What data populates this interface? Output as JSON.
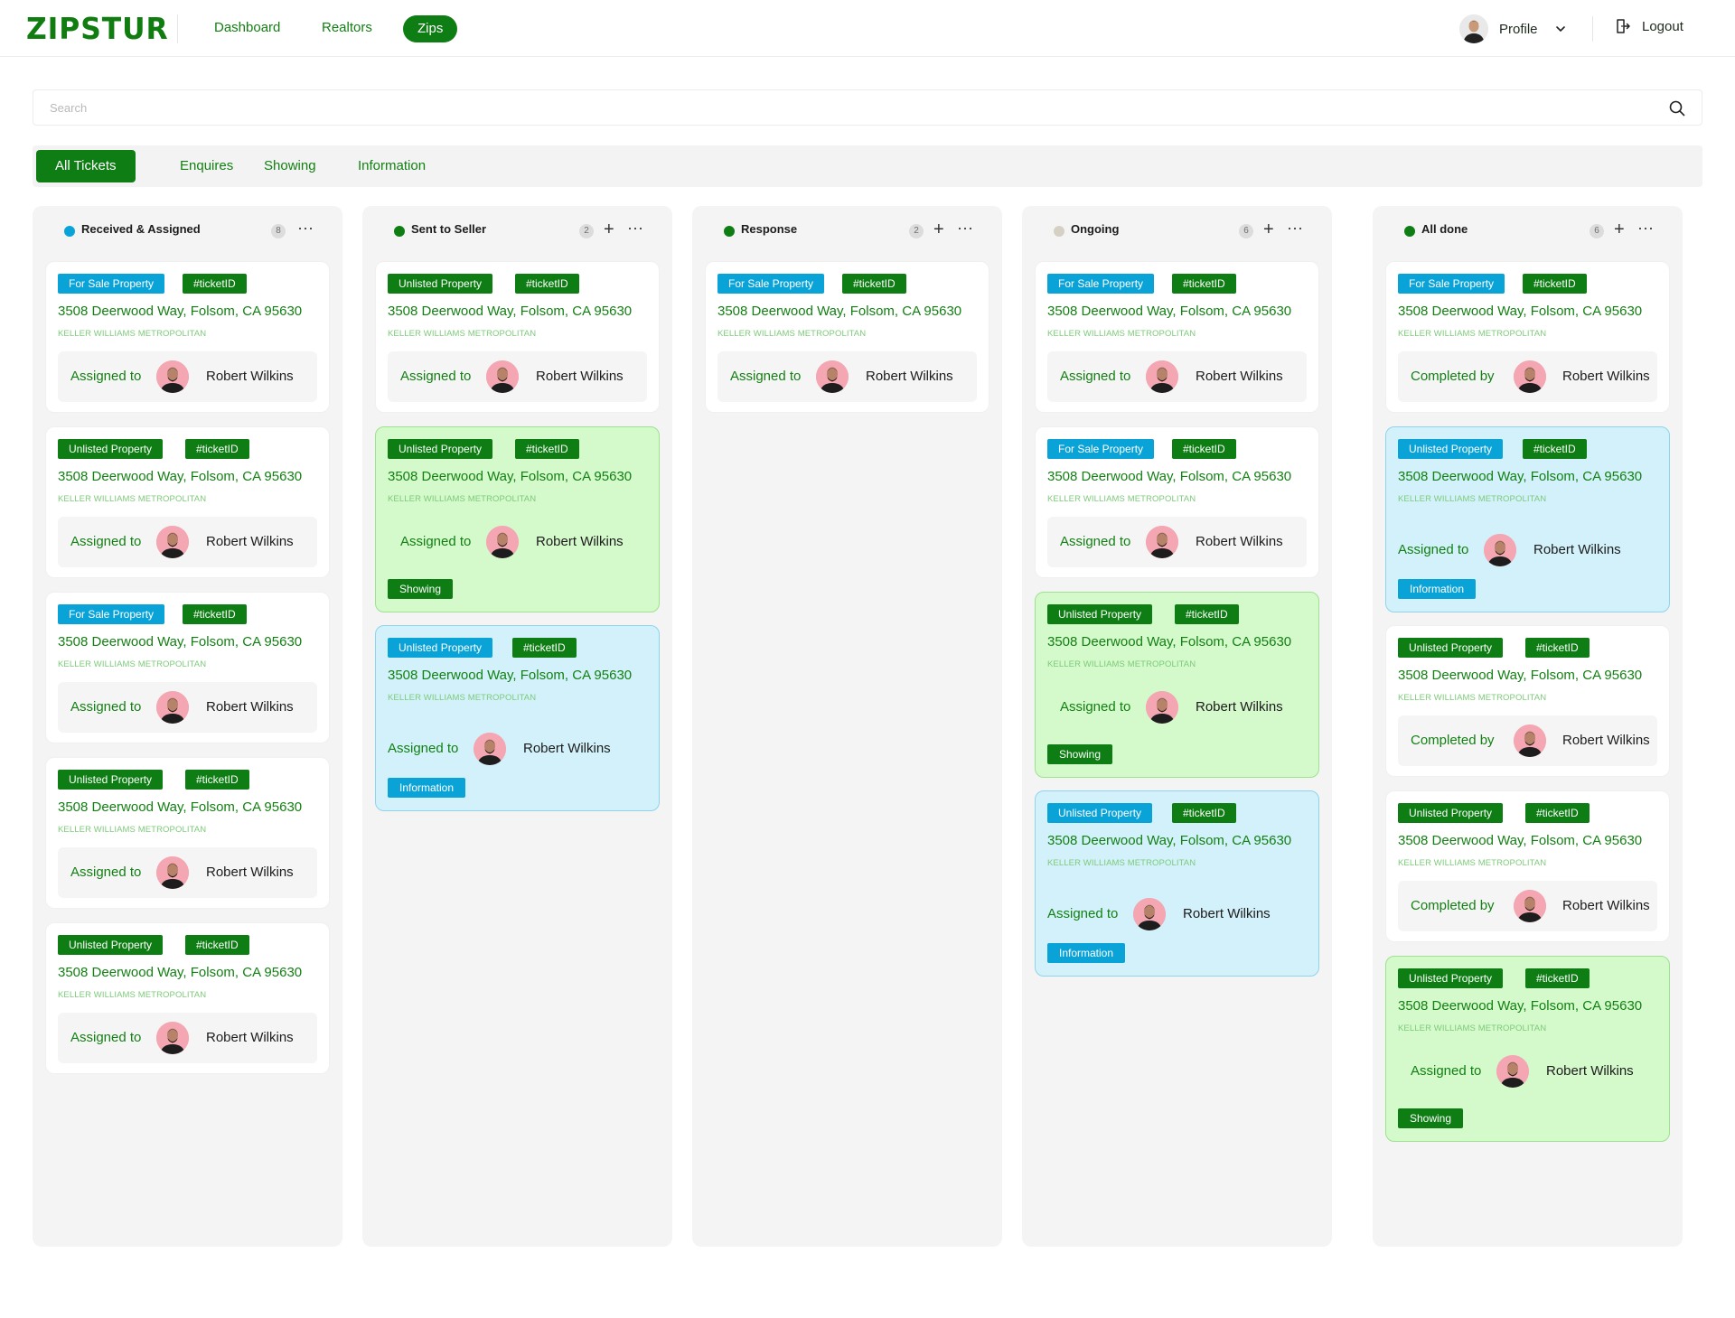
{
  "app": {
    "logo": "ZIPSTUR",
    "nav": [
      "Dashboard",
      "Realtors",
      "Zips"
    ],
    "profile_label": "Profile",
    "logout_label": "Logout"
  },
  "search": {
    "placeholder": "Search"
  },
  "tabs": [
    "All Tickets",
    "Enquires",
    "Showing",
    "Information"
  ],
  "colors": {
    "brand_green": "#0e7d14",
    "sale_blue": "#0aa3d8",
    "showing_bg": "#d4f9cb",
    "info_bg": "#d2f1fa"
  },
  "columns": [
    {
      "title": "Received & Assigned",
      "count": "8",
      "dot": "#0aa3d8",
      "has_plus": false,
      "cards": [
        {
          "type": "For Sale Property",
          "kind": "sale",
          "ticket": "#ticketID",
          "address": "3508 Deerwood Way, Folsom, CA 95630",
          "agency": "KELLER WILLIAMS METROPOLITAN",
          "by_label": "Assigned to",
          "person": "Robert Wilkins",
          "style": "plain",
          "status": ""
        },
        {
          "type": "Unlisted Property",
          "kind": "unlisted",
          "ticket": "#ticketID",
          "address": "3508 Deerwood Way, Folsom, CA 95630",
          "agency": "KELLER WILLIAMS METROPOLITAN",
          "by_label": "Assigned to",
          "person": "Robert Wilkins",
          "style": "plain",
          "status": ""
        },
        {
          "type": "For Sale Property",
          "kind": "sale",
          "ticket": "#ticketID",
          "address": "3508 Deerwood Way, Folsom, CA 95630",
          "agency": "KELLER WILLIAMS METROPOLITAN",
          "by_label": "Assigned to",
          "person": "Robert Wilkins",
          "style": "plain",
          "status": ""
        },
        {
          "type": "Unlisted Property",
          "kind": "unlisted",
          "ticket": "#ticketID",
          "address": "3508 Deerwood Way, Folsom, CA 95630",
          "agency": "KELLER WILLIAMS METROPOLITAN",
          "by_label": "Assigned to",
          "person": "Robert Wilkins",
          "style": "plain",
          "status": ""
        },
        {
          "type": "Unlisted Property",
          "kind": "unlisted",
          "ticket": "#ticketID",
          "address": "3508 Deerwood Way, Folsom, CA 95630",
          "agency": "KELLER WILLIAMS METROPOLITAN",
          "by_label": "Assigned to",
          "person": "Robert Wilkins",
          "style": "plain",
          "status": ""
        }
      ]
    },
    {
      "title": "Sent to Seller",
      "count": "2",
      "dot": "#0e7d14",
      "has_plus": true,
      "cards": [
        {
          "type": "Unlisted Property",
          "kind": "unlisted",
          "ticket": "#ticketID",
          "address": "3508 Deerwood Way, Folsom, CA 95630",
          "agency": "KELLER WILLIAMS METROPOLITAN",
          "by_label": "Assigned to",
          "person": "Robert Wilkins",
          "style": "plain",
          "status": ""
        },
        {
          "type": "Unlisted Property",
          "kind": "unlisted",
          "ticket": "#ticketID",
          "address": "3508 Deerwood Way, Folsom, CA 95630",
          "agency": "KELLER WILLIAMS METROPOLITAN",
          "by_label": "Assigned to",
          "person": "Robert Wilkins",
          "style": "green",
          "status": "Showing"
        },
        {
          "type": "Unlisted Property",
          "kind": "sale",
          "ticket": "#ticketID",
          "address": "3508 Deerwood Way, Folsom, CA 95630",
          "agency": "KELLER WILLIAMS METROPOLITAN",
          "by_label": "Assigned to",
          "person": "Robert Wilkins",
          "style": "blue",
          "status": "Information"
        }
      ]
    },
    {
      "title": "Response",
      "count": "2",
      "dot": "#0e7d14",
      "has_plus": true,
      "cards": [
        {
          "type": "For Sale Property",
          "kind": "sale",
          "ticket": "#ticketID",
          "address": "3508 Deerwood Way, Folsom, CA 95630",
          "agency": "KELLER WILLIAMS METROPOLITAN",
          "by_label": "Assigned to",
          "person": "Robert Wilkins",
          "style": "plain",
          "status": ""
        }
      ]
    },
    {
      "title": "Ongoing",
      "count": "6",
      "dot": "#d6d0c4",
      "has_plus": true,
      "cards": [
        {
          "type": "For Sale Property",
          "kind": "sale",
          "ticket": "#ticketID",
          "address": "3508 Deerwood Way, Folsom, CA 95630",
          "agency": "KELLER WILLIAMS METROPOLITAN",
          "by_label": "Assigned to",
          "person": "Robert Wilkins",
          "style": "plain",
          "status": ""
        },
        {
          "type": "For Sale Property",
          "kind": "sale",
          "ticket": "#ticketID",
          "address": "3508 Deerwood Way, Folsom, CA 95630",
          "agency": "KELLER WILLIAMS METROPOLITAN",
          "by_label": "Assigned to",
          "person": "Robert Wilkins",
          "style": "plain",
          "status": ""
        },
        {
          "type": "Unlisted Property",
          "kind": "unlisted",
          "ticket": "#ticketID",
          "address": "3508 Deerwood Way, Folsom, CA 95630",
          "agency": "KELLER WILLIAMS METROPOLITAN",
          "by_label": "Assigned to",
          "person": "Robert Wilkins",
          "style": "green",
          "status": "Showing"
        },
        {
          "type": "Unlisted Property",
          "kind": "sale",
          "ticket": "#ticketID",
          "address": "3508 Deerwood Way, Folsom, CA 95630",
          "agency": "KELLER WILLIAMS METROPOLITAN",
          "by_label": "Assigned to",
          "person": "Robert Wilkins",
          "style": "blue",
          "status": "Information"
        }
      ]
    },
    {
      "title": "All done",
      "count": "6",
      "dot": "#0e7d14",
      "has_plus": true,
      "cards": [
        {
          "type": "For Sale Property",
          "kind": "sale",
          "ticket": "#ticketID",
          "address": "3508 Deerwood Way, Folsom, CA 95630",
          "agency": "KELLER WILLIAMS METROPOLITAN",
          "by_label": "Completed by",
          "person": "Robert Wilkins",
          "style": "plain",
          "status": ""
        },
        {
          "type": "Unlisted Property",
          "kind": "sale",
          "ticket": "#ticketID",
          "address": "3508 Deerwood Way, Folsom, CA 95630",
          "agency": "KELLER WILLIAMS METROPOLITAN",
          "by_label": "Assigned to",
          "person": "Robert Wilkins",
          "style": "blue",
          "status": "Information"
        },
        {
          "type": "Unlisted Property",
          "kind": "unlisted",
          "ticket": "#ticketID",
          "address": "3508 Deerwood Way, Folsom, CA 95630",
          "agency": "KELLER WILLIAMS METROPOLITAN",
          "by_label": "Completed by",
          "person": "Robert Wilkins",
          "style": "plain",
          "status": ""
        },
        {
          "type": "Unlisted Property",
          "kind": "unlisted",
          "ticket": "#ticketID",
          "address": "3508 Deerwood Way, Folsom, CA 95630",
          "agency": "KELLER WILLIAMS METROPOLITAN",
          "by_label": "Completed by",
          "person": "Robert Wilkins",
          "style": "plain",
          "status": ""
        },
        {
          "type": "Unlisted Property",
          "kind": "unlisted",
          "ticket": "#ticketID",
          "address": "3508 Deerwood Way, Folsom, CA 95630",
          "agency": "KELLER WILLIAMS METROPOLITAN",
          "by_label": "Assigned to",
          "person": "Robert Wilkins",
          "style": "green",
          "status": "Showing"
        }
      ]
    }
  ]
}
